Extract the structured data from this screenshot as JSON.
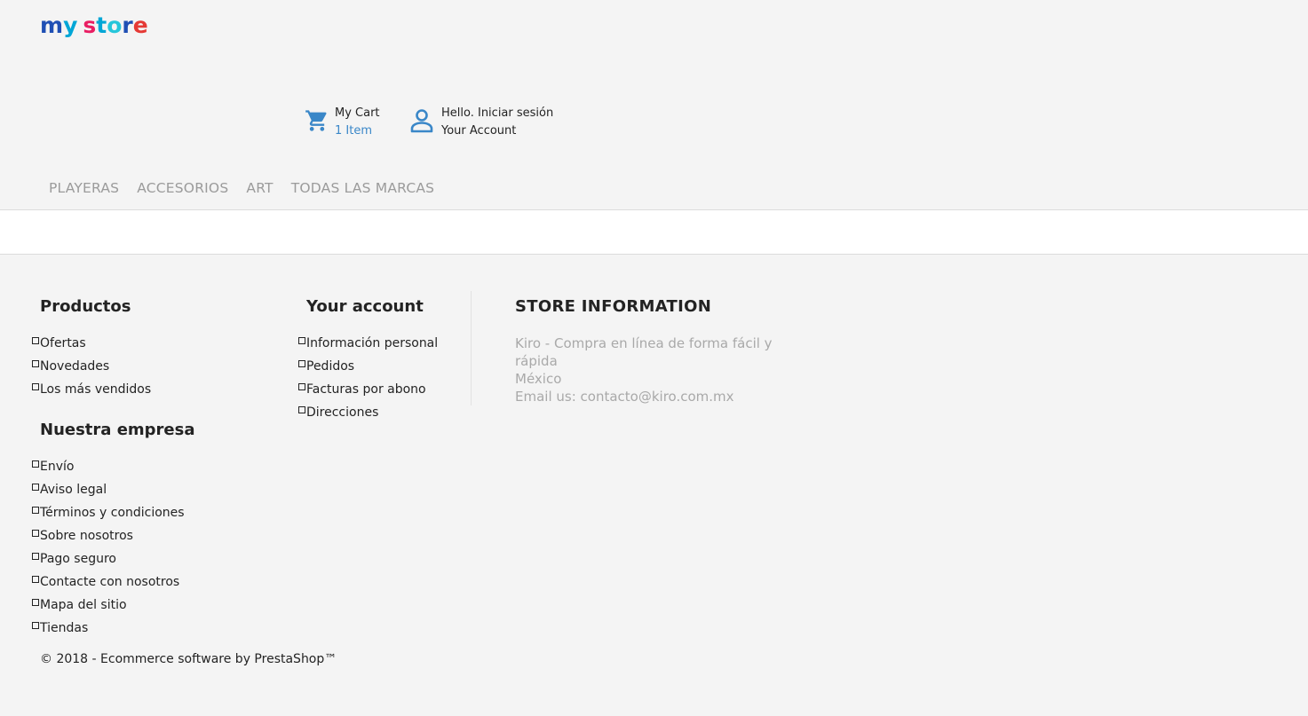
{
  "header": {
    "logo": {
      "letters": [
        {
          "ch": "m",
          "color": "#1f4fb4"
        },
        {
          "ch": "y",
          "color": "#00a6d6"
        },
        {
          "ch": " ",
          "color": "#000000"
        },
        {
          "ch": "s",
          "color": "#e91e63"
        },
        {
          "ch": "t",
          "color": "#00a6d6"
        },
        {
          "ch": "o",
          "color": "#26c6da"
        },
        {
          "ch": "r",
          "color": "#1f4fb4"
        },
        {
          "ch": "e",
          "color": "#e53935"
        }
      ]
    },
    "cart": {
      "label": "My Cart",
      "count": "1 Item"
    },
    "account": {
      "greeting": "Hello. Iniciar sesión",
      "label": "Your Account"
    }
  },
  "menu": {
    "items": [
      "PLAYERAS",
      "ACCESORIOS",
      "ART",
      "TODAS LAS MARCAS"
    ]
  },
  "footer": {
    "productos": {
      "title": "Productos",
      "links": [
        "Ofertas",
        "Novedades",
        "Los más vendidos"
      ]
    },
    "empresa": {
      "title": "Nuestra empresa",
      "links": [
        "Envío",
        "Aviso legal",
        "Términos y condiciones",
        "Sobre nosotros",
        "Pago seguro",
        "Contacte con nosotros",
        "Mapa del sitio",
        "Tiendas"
      ]
    },
    "account": {
      "title": "Your account",
      "links": [
        "Información personal",
        "Pedidos",
        "Facturas por abono",
        "Direcciones"
      ]
    },
    "store": {
      "title": "STORE INFORMATION",
      "lines": [
        "Kiro - Compra en línea de forma fácil y rápida",
        "México",
        "Email us: contacto@kiro.com.mx"
      ]
    },
    "copyright": "© 2018 - Ecommerce software by PrestaShop™"
  },
  "colors": {
    "accent_blue": "#3a87c8",
    "menu_gray": "#9b9b9b"
  }
}
